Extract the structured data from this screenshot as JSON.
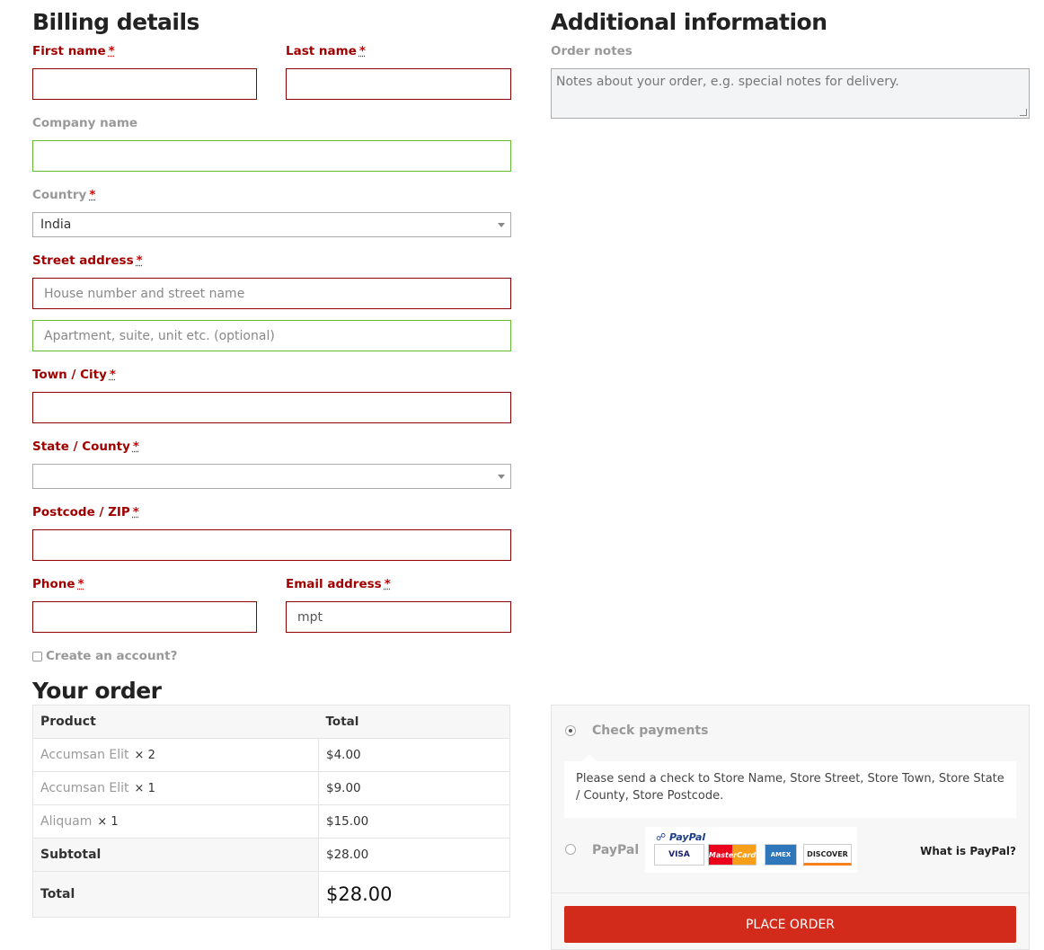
{
  "billing": {
    "title": "Billing details",
    "first_name": {
      "label": "First name",
      "req": "*",
      "value": ""
    },
    "last_name": {
      "label": "Last name",
      "req": "*",
      "value": ""
    },
    "company": {
      "label": "Company name",
      "value": ""
    },
    "country": {
      "label": "Country",
      "req": "*",
      "selected": "India"
    },
    "street": {
      "label": "Street address",
      "req": "*",
      "placeholder1": "House number and street name",
      "placeholder2": "Apartment, suite, unit etc. (optional)"
    },
    "city": {
      "label": "Town / City",
      "req": "*",
      "value": ""
    },
    "state": {
      "label": "State / County",
      "req": "*",
      "selected": ""
    },
    "postcode": {
      "label": "Postcode / ZIP",
      "req": "*",
      "value": ""
    },
    "phone": {
      "label": "Phone",
      "req": "*",
      "value": ""
    },
    "email": {
      "label": "Email address",
      "req": "*",
      "value": "mpt"
    },
    "create_account": "Create an account?"
  },
  "additional": {
    "title": "Additional information",
    "notes_label": "Order notes",
    "notes_placeholder": "Notes about your order, e.g. special notes for delivery."
  },
  "order": {
    "title": "Your order",
    "col_product": "Product",
    "col_total": "Total",
    "items": [
      {
        "name": "Accumsan Elit",
        "qty": "× 2",
        "total": "$4.00"
      },
      {
        "name": "Accumsan Elit",
        "qty": "× 1",
        "total": "$9.00"
      },
      {
        "name": "Aliquam",
        "qty": "× 1",
        "total": "$15.00"
      }
    ],
    "subtotal_label": "Subtotal",
    "subtotal": "$28.00",
    "total_label": "Total",
    "total": "$28.00"
  },
  "payment": {
    "check_label": "Check payments",
    "check_desc": "Please send a check to Store Name, Store Street, Store Town, Store State / County, Store Postcode.",
    "paypal_label": "PayPal",
    "paypal_logo_text": "PayPal",
    "cards": [
      "VISA",
      "MasterCard",
      "AMEX",
      "DISCOVER"
    ],
    "what_paypal": "What is PayPal?",
    "place_order": "PLACE ORDER"
  }
}
